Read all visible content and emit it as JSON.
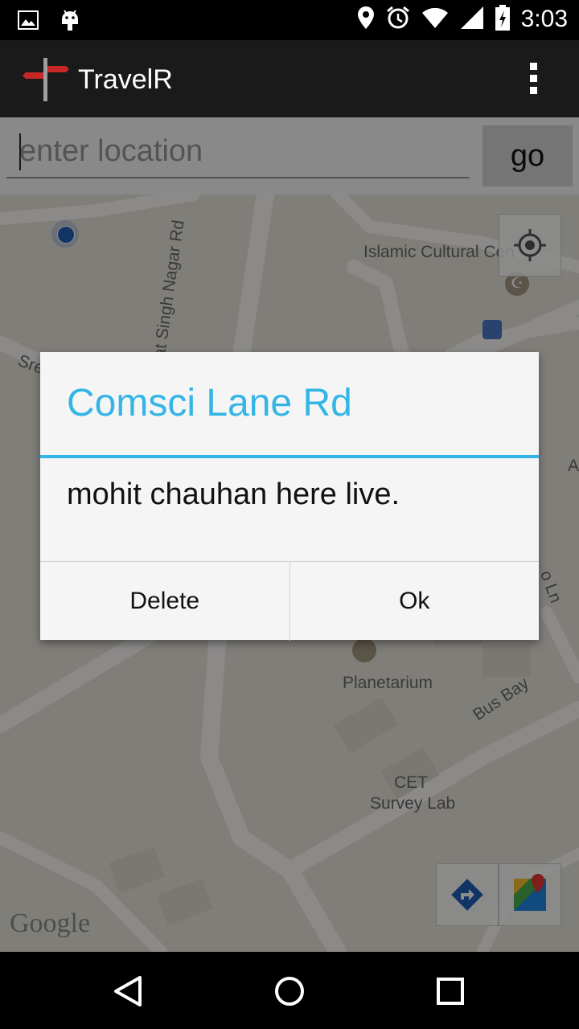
{
  "status_bar": {
    "time": "3:03",
    "icons_left": [
      "image-icon",
      "android-icon"
    ],
    "icons_right": [
      "location-icon",
      "alarm-icon",
      "wifi-icon",
      "signal-icon",
      "battery-charging-icon"
    ]
  },
  "app_bar": {
    "title": "TravelR",
    "logo_icon": "signpost-icon",
    "menu_icon": "overflow-menu-icon"
  },
  "search": {
    "placeholder": "enter location",
    "value": "",
    "go_label": "go"
  },
  "map": {
    "labels": {
      "road_1": "Bhagat Singh Nagar Rd",
      "islamic": "Islamic Cultural Cen",
      "planetarium": "Planetarium",
      "bus_bay": "Bus Bay",
      "cet_line1": "CET",
      "cet_line2": "Survey Lab",
      "road_left": "Sre",
      "lane": "o Ln",
      "edge_a": "A",
      "google": "Google"
    },
    "controls": [
      "my-location-button",
      "directions-button",
      "google-maps-button"
    ]
  },
  "dialog": {
    "title": "Comsci Lane Rd",
    "message": "mohit chauhan here live.",
    "buttons": {
      "negative": "Delete",
      "positive": "Ok"
    }
  },
  "colors": {
    "accent": "#33b5e5",
    "app_bar": "#1a1a1a",
    "map_bg": "#e9e5dc"
  },
  "nav_bar": [
    "back-icon",
    "home-icon",
    "recents-icon"
  ]
}
